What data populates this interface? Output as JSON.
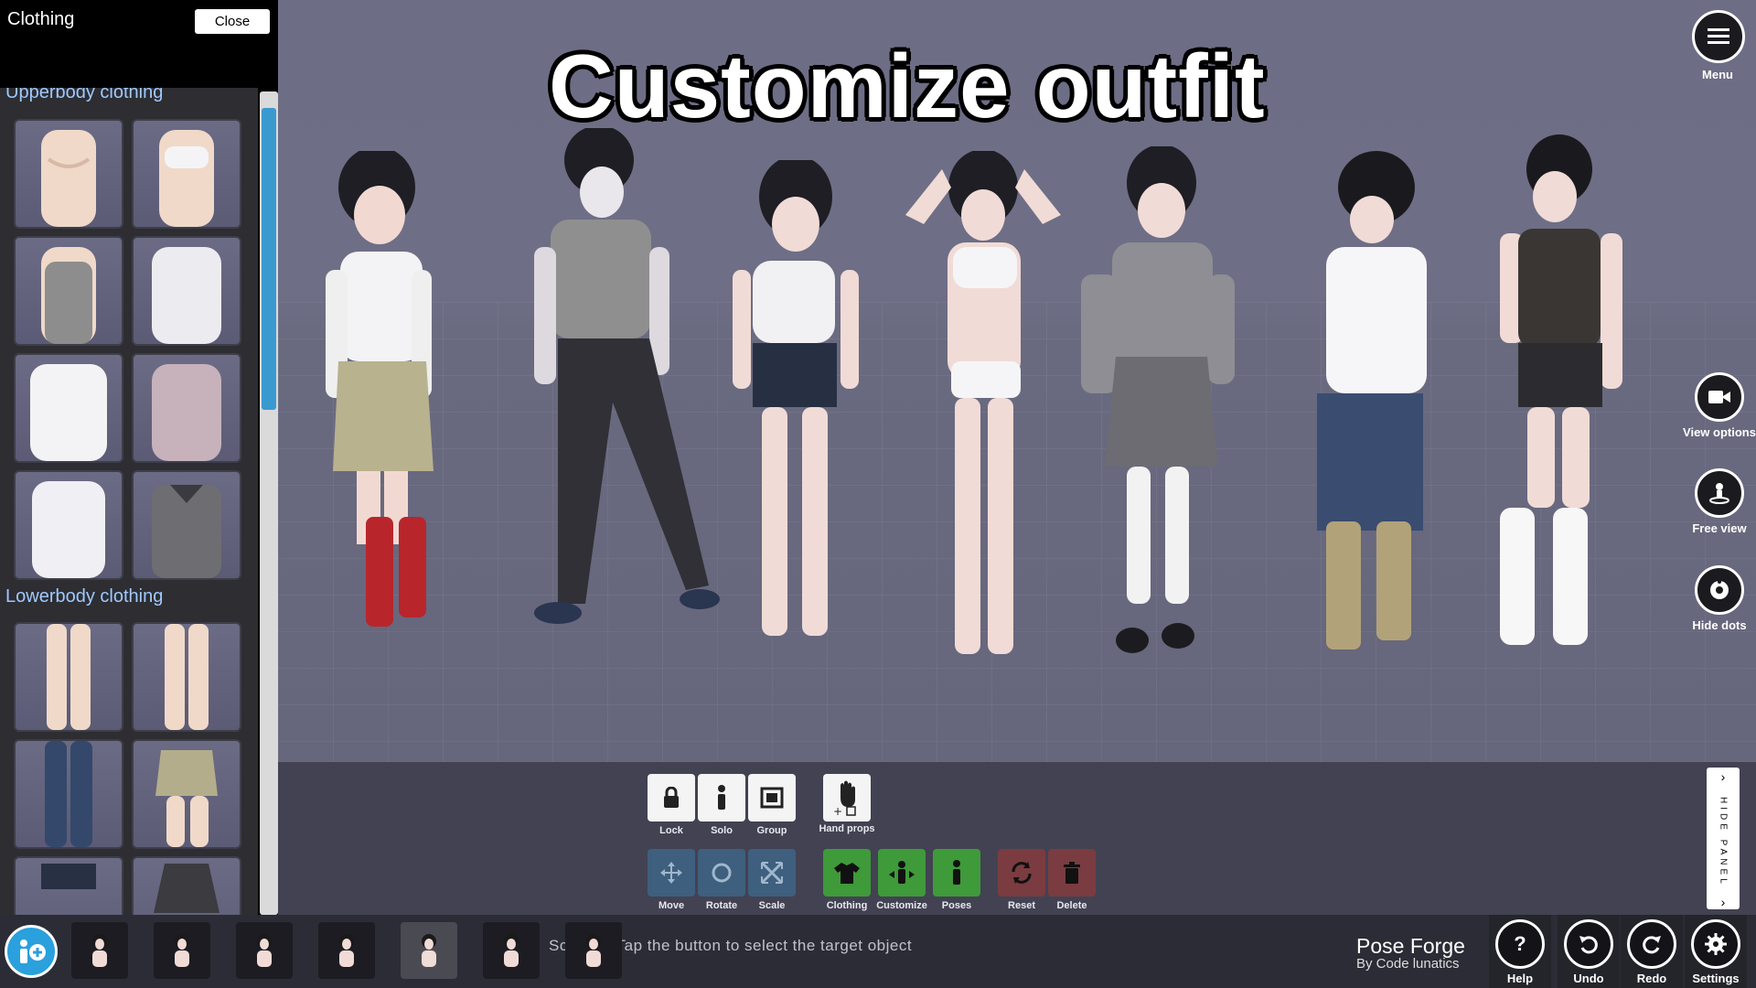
{
  "viewport": {
    "title": "Customize outfit"
  },
  "left_panel": {
    "title": "Clothing",
    "close_label": "Close",
    "sections": [
      {
        "label": "Upperbody clothing"
      },
      {
        "label": "Lowerbody clothing"
      }
    ]
  },
  "right_controls": {
    "menu": "Menu",
    "view_options": "View options",
    "free_view": "Free view",
    "hide_dots": "Hide dots"
  },
  "toolbar": {
    "lock": "Lock",
    "solo": "Solo",
    "group": "Group",
    "hand_props": "Hand props",
    "move": "Move",
    "rotate": "Rotate",
    "scale": "Scale",
    "clothing": "Clothing",
    "customize": "Customize",
    "poses": "Poses",
    "reset": "Reset",
    "delete": "Delete",
    "hide_panel": "HIDE PANEL"
  },
  "bottom_bar": {
    "status": "Sc         jects. Tap the button to select the target object",
    "brand": "Pose Forge",
    "brand_sub": "By Code lunatics",
    "help": "Help",
    "undo": "Undo",
    "redo": "Redo",
    "settings": "Settings"
  },
  "colors": {
    "accent_blue": "#3a9ad0",
    "green": "#3f9a3a",
    "red": "#7a3c40",
    "steel": "#3f5f7e"
  }
}
